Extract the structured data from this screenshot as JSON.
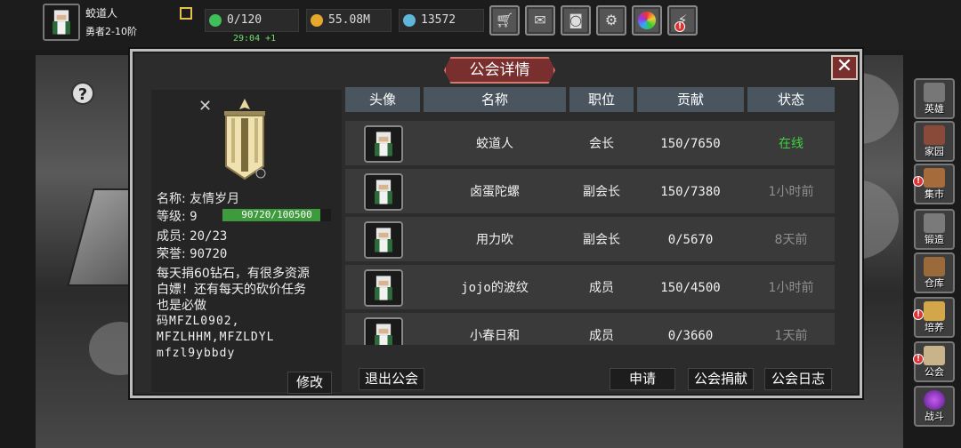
{
  "player": {
    "name": "蛟道人",
    "rank": "勇者2-10阶"
  },
  "resources": {
    "energy": "0/120",
    "energy_timer": "29:04 +1",
    "gold": "55.08M",
    "gems": "13572"
  },
  "toolbar": [
    {
      "icon": "shop-cart-icon"
    },
    {
      "icon": "mail-icon"
    },
    {
      "icon": "gamepad-icon"
    },
    {
      "icon": "gear-icon"
    },
    {
      "icon": "color-wheel-icon"
    },
    {
      "icon": "alert-icon",
      "badge": "!"
    }
  ],
  "side_menu": [
    {
      "label": "英雄",
      "badge": ""
    },
    {
      "label": "家园",
      "badge": ""
    },
    {
      "label": "集市",
      "badge": "!"
    },
    {
      "label": "锻造",
      "badge": ""
    },
    {
      "label": "仓库",
      "badge": ""
    },
    {
      "label": "培养",
      "badge": "!"
    },
    {
      "label": "公会",
      "badge": "!"
    },
    {
      "label": "战斗",
      "badge": ""
    }
  ],
  "dialog": {
    "title": "公会详情",
    "close": "✕",
    "guild": {
      "name_label": "名称:",
      "name": "友情岁月",
      "level_label": "等级:",
      "level": "9",
      "xp": "90720/100500",
      "xp_fraction": 0.9027,
      "members_label": "成员:",
      "members": "20/23",
      "honor_label": "荣誉:",
      "honor": "90720",
      "notice_lines": [
        "每天捐60钻石，有很多资源",
        "白嫖！还有每天的砍价任务",
        "也是必做"
      ],
      "codes": [
        "码MFZL0902,",
        "MFZLHHM,MFZLDYL",
        "mfzl9ybbdy"
      ]
    },
    "buttons": {
      "edit": "修改",
      "leave": "退出公会",
      "apply": "申请",
      "donate": "公会捐献",
      "log": "公会日志"
    },
    "columns": [
      "头像",
      "名称",
      "职位",
      "贡献",
      "状态"
    ],
    "members": [
      {
        "name": "蛟道人",
        "role": "会长",
        "contribution": "150/7650",
        "status": "在线",
        "online": true
      },
      {
        "name": "卤蛋陀螺",
        "role": "副会长",
        "contribution": "150/7380",
        "status": "1小时前",
        "online": false
      },
      {
        "name": "用力吹",
        "role": "副会长",
        "contribution": "0/5670",
        "status": "8天前",
        "online": false
      },
      {
        "name": "jojo的波纹",
        "role": "成员",
        "contribution": "150/4500",
        "status": "1小时前",
        "online": false
      },
      {
        "name": "小春日和",
        "role": "成员",
        "contribution": "0/3660",
        "status": "1天前",
        "online": false
      }
    ]
  },
  "colors": {
    "online": "#3fd13f",
    "offline": "#8f8f8f",
    "accent": "#7a2f2f"
  }
}
